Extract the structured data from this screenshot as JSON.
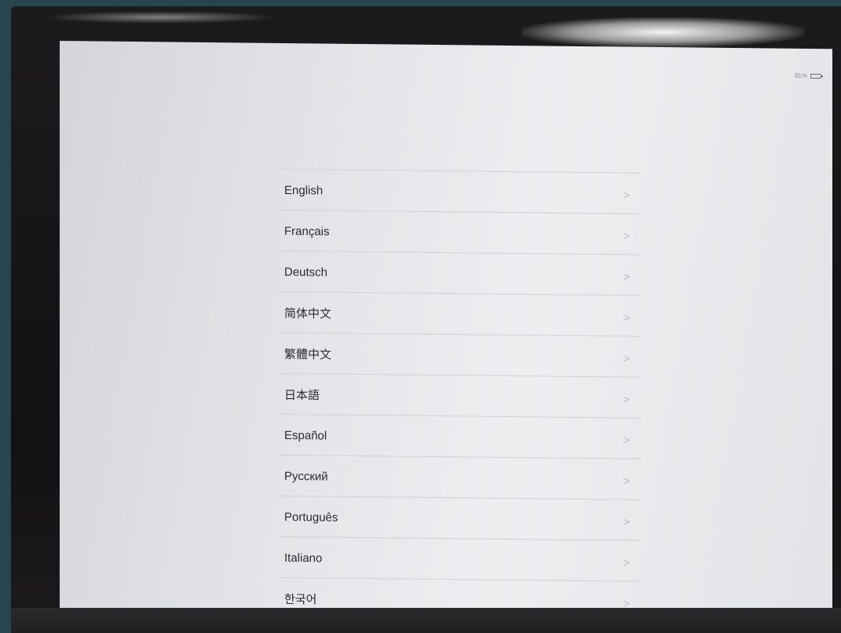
{
  "status_bar": {
    "battery_text": "81%",
    "battery_icon": "battery-icon"
  },
  "language_list": {
    "items": [
      {
        "label": "English"
      },
      {
        "label": "Français"
      },
      {
        "label": "Deutsch"
      },
      {
        "label": "简体中文"
      },
      {
        "label": "繁體中文"
      },
      {
        "label": "日本語"
      },
      {
        "label": "Español"
      },
      {
        "label": "Русский"
      },
      {
        "label": "Português"
      },
      {
        "label": "Italiano"
      },
      {
        "label": "한국어"
      }
    ],
    "chevron_icon": "chevron-right-icon",
    "chevron_glyph": ">"
  }
}
